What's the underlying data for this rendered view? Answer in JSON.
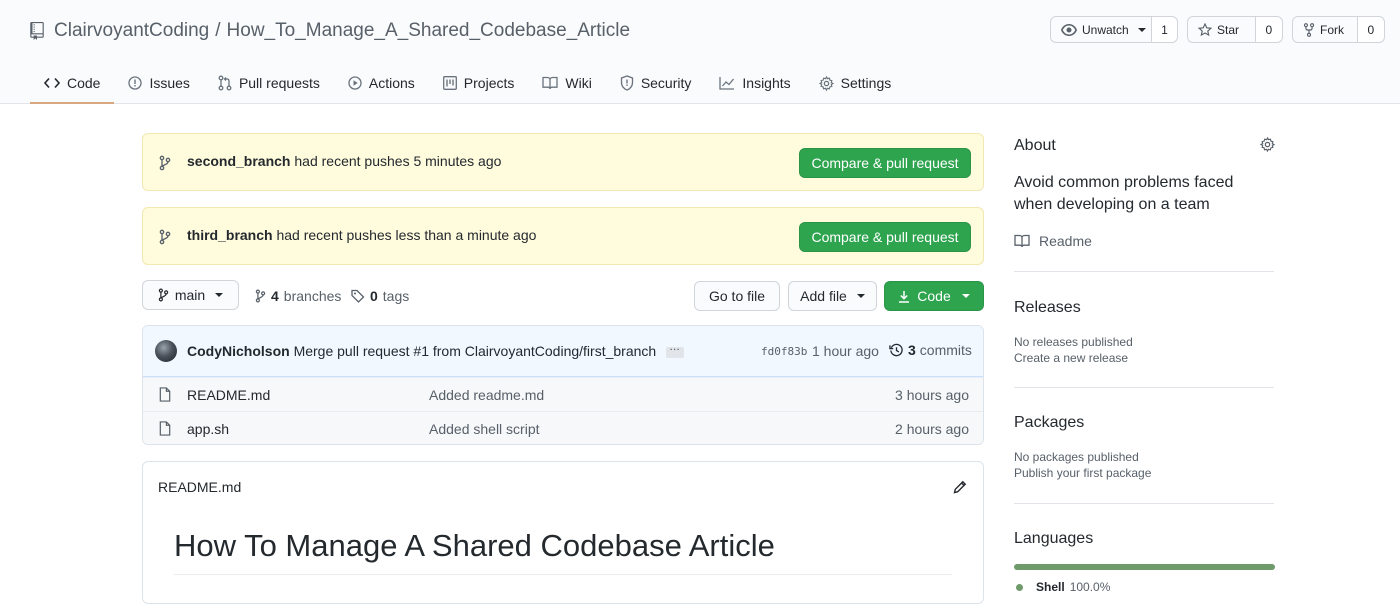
{
  "header": {
    "owner": "ClairvoyantCoding",
    "separator": "/",
    "repo_name": "How_To_Manage_A_Shared_Codebase_Article",
    "actions": [
      {
        "label": "Unwatch",
        "count": "1",
        "icon": "eye-icon"
      },
      {
        "label": "Star",
        "count": "0",
        "icon": "star-icon"
      },
      {
        "label": "Fork",
        "count": "0",
        "icon": "fork-icon"
      }
    ]
  },
  "tabs": [
    {
      "label": "Code",
      "icon": "code-icon",
      "active": true
    },
    {
      "label": "Issues",
      "icon": "issue-icon"
    },
    {
      "label": "Pull requests",
      "icon": "pull-request-icon"
    },
    {
      "label": "Actions",
      "icon": "play-icon"
    },
    {
      "label": "Projects",
      "icon": "project-icon"
    },
    {
      "label": "Wiki",
      "icon": "book-icon"
    },
    {
      "label": "Security",
      "icon": "shield-icon"
    },
    {
      "label": "Insights",
      "icon": "graph-icon"
    },
    {
      "label": "Settings",
      "icon": "gear-icon"
    }
  ],
  "banners": [
    {
      "branch": "second_branch",
      "text": "had recent pushes 5 minutes ago",
      "button": "Compare & pull request"
    },
    {
      "branch": "third_branch",
      "text": "had recent pushes less than a minute ago",
      "button": "Compare & pull request"
    }
  ],
  "branch_bar": {
    "branch": "main",
    "branches_count": "4",
    "branches_label": "branches",
    "tags_count": "0",
    "tags_label": "tags",
    "go_to_file": "Go to file",
    "add_file": "Add file",
    "code": "Code"
  },
  "latest_commit": {
    "author": "CodyNicholson",
    "message": "Merge pull request #1 from ClairvoyantCoding/first_branch",
    "sha": "fd0f83b",
    "time": "1 hour ago",
    "commits_count": "3",
    "commits_label": "commits"
  },
  "files": [
    {
      "name": "README.md",
      "message": "Added readme.md",
      "age": "3 hours ago"
    },
    {
      "name": "app.sh",
      "message": "Added shell script",
      "age": "2 hours ago"
    }
  ],
  "readme": {
    "filename": "README.md",
    "heading": "How To Manage A Shared Codebase Article"
  },
  "sidebar": {
    "about_title": "About",
    "description": "Avoid common problems faced when developing on a team",
    "readme_link": "Readme",
    "releases_title": "Releases",
    "releases_none": "No releases published",
    "releases_create": "Create a new release",
    "packages_title": "Packages",
    "packages_none": "No packages published",
    "packages_publish": "Publish your first package",
    "languages_title": "Languages",
    "language": "Shell",
    "language_percent": "100.0%",
    "language_share": 1.0,
    "language_color": "#89e051"
  },
  "colors": {
    "accent_green": "#2ea44f",
    "banner_bg": "#fffbdd",
    "active_tab_underline": "#d9a77f"
  }
}
